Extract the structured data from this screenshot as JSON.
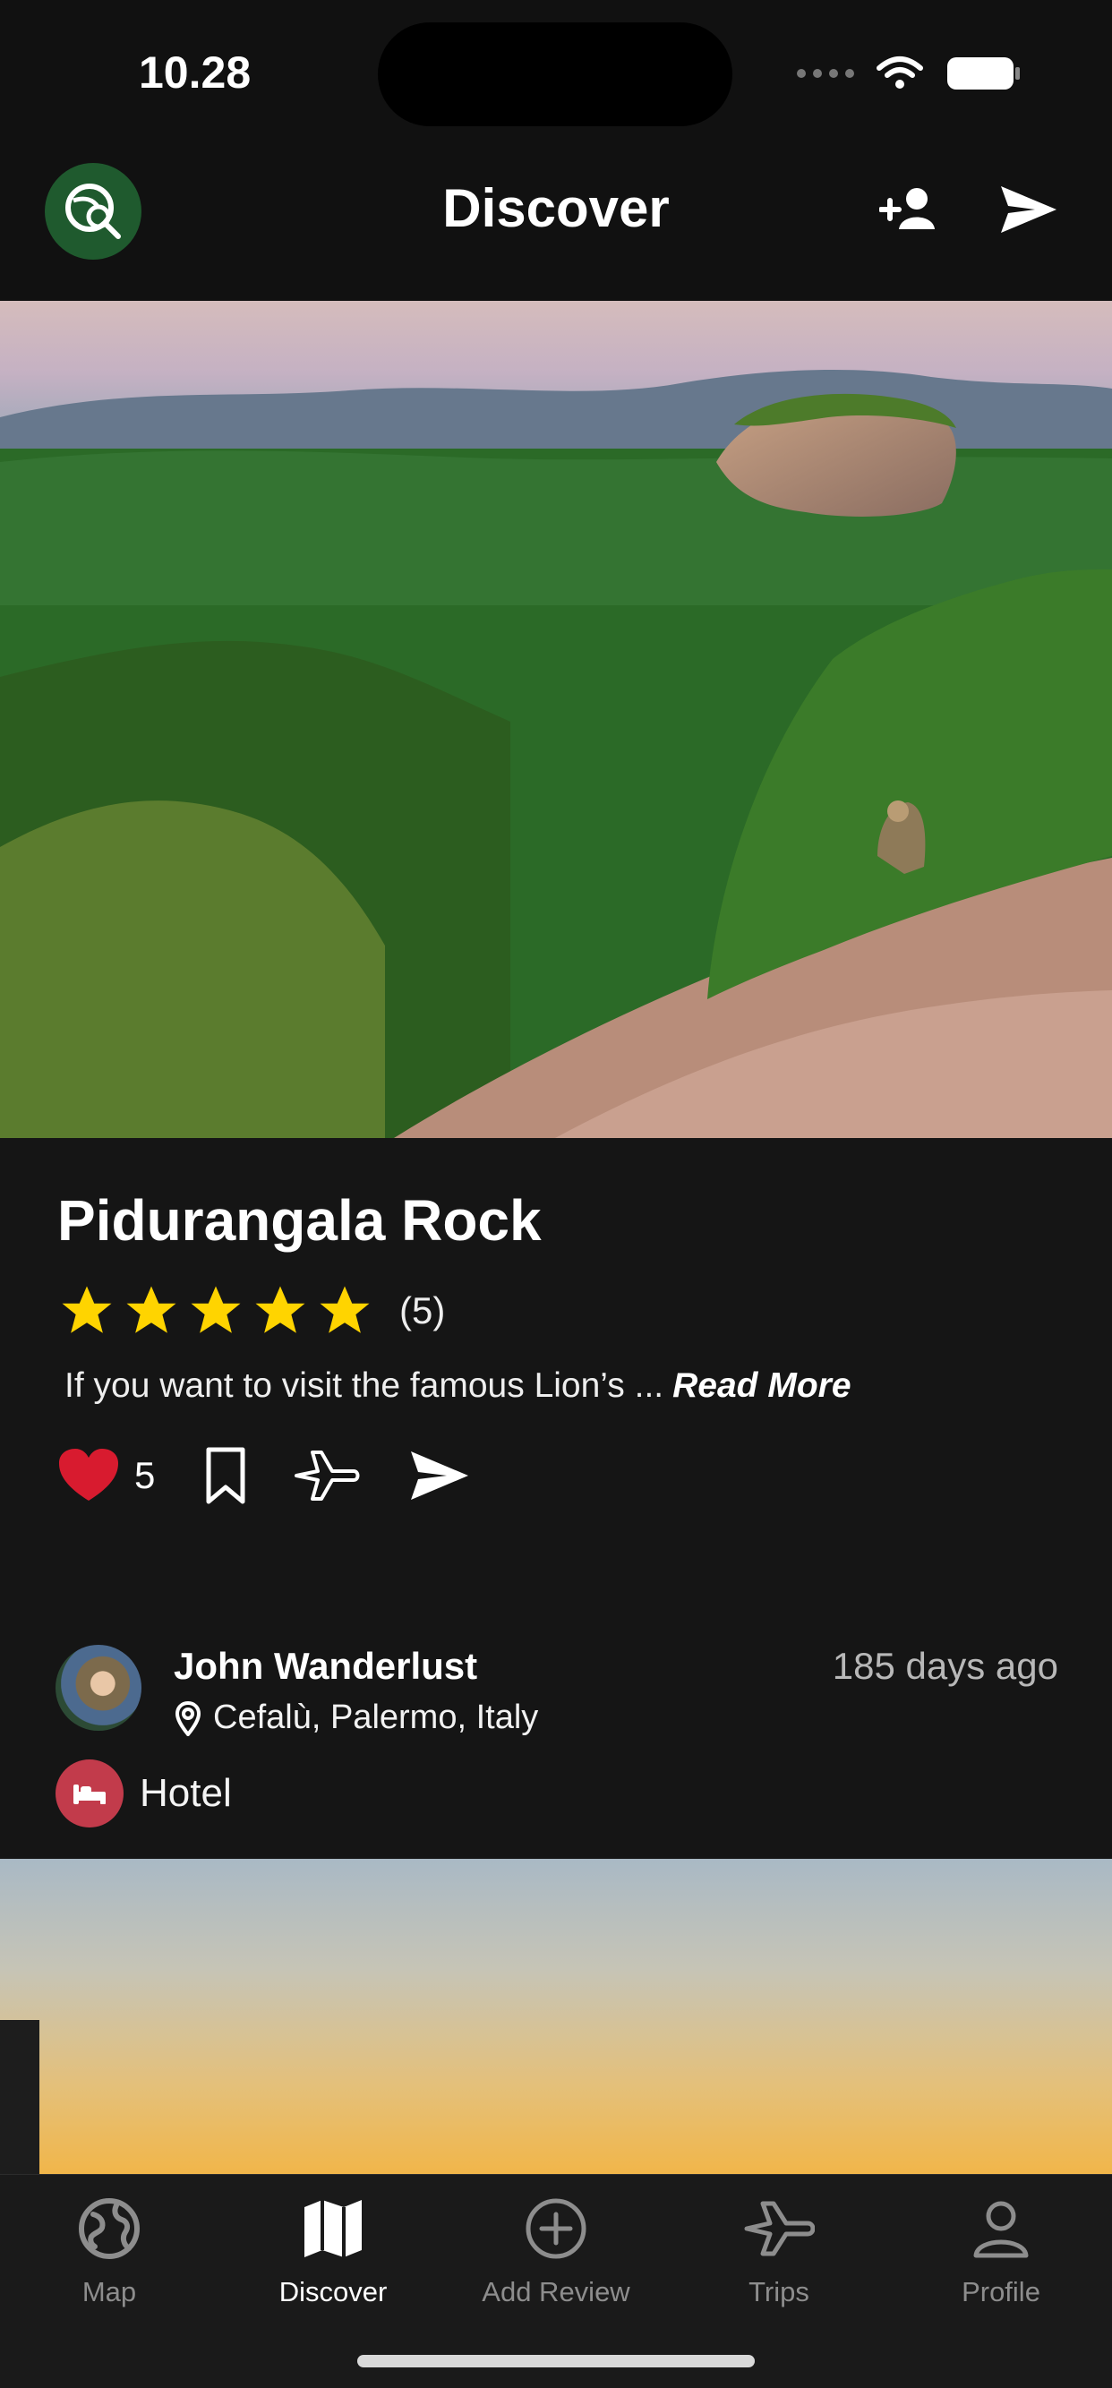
{
  "status_bar": {
    "time": "10.28"
  },
  "header": {
    "title": "Discover"
  },
  "post": {
    "title": "Pidurangala Rock",
    "rating": 5,
    "rating_count": "(5)",
    "description": "If you want to visit the famous Lion’s ...",
    "read_more_label": "Read More",
    "likes": "5",
    "author": {
      "name": "John Wanderlust",
      "location": "Cefalù, Palermo, Italy",
      "posted_ago": "185 days ago"
    },
    "category": "Hotel"
  },
  "tabs": [
    {
      "label": "Map"
    },
    {
      "label": "Discover"
    },
    {
      "label": "Add Review"
    },
    {
      "label": "Trips"
    },
    {
      "label": "Profile"
    }
  ],
  "colors": {
    "background": "#111111",
    "card": "#151515",
    "logo_green": "#1f5a2e",
    "like_red": "#d81b2f",
    "star_yellow": "#ffd400",
    "category_red": "#c23b4b",
    "active_tab": "#ffffff",
    "inactive_tab": "#8d8d8d"
  },
  "icons": {
    "logo": "globe-search-icon",
    "add_friend": "add-person-icon",
    "send": "send-icon",
    "heart": "heart-icon",
    "bookmark": "bookmark-icon",
    "trip": "plane-icon",
    "location": "location-pin-icon",
    "hotel": "bed-icon"
  }
}
